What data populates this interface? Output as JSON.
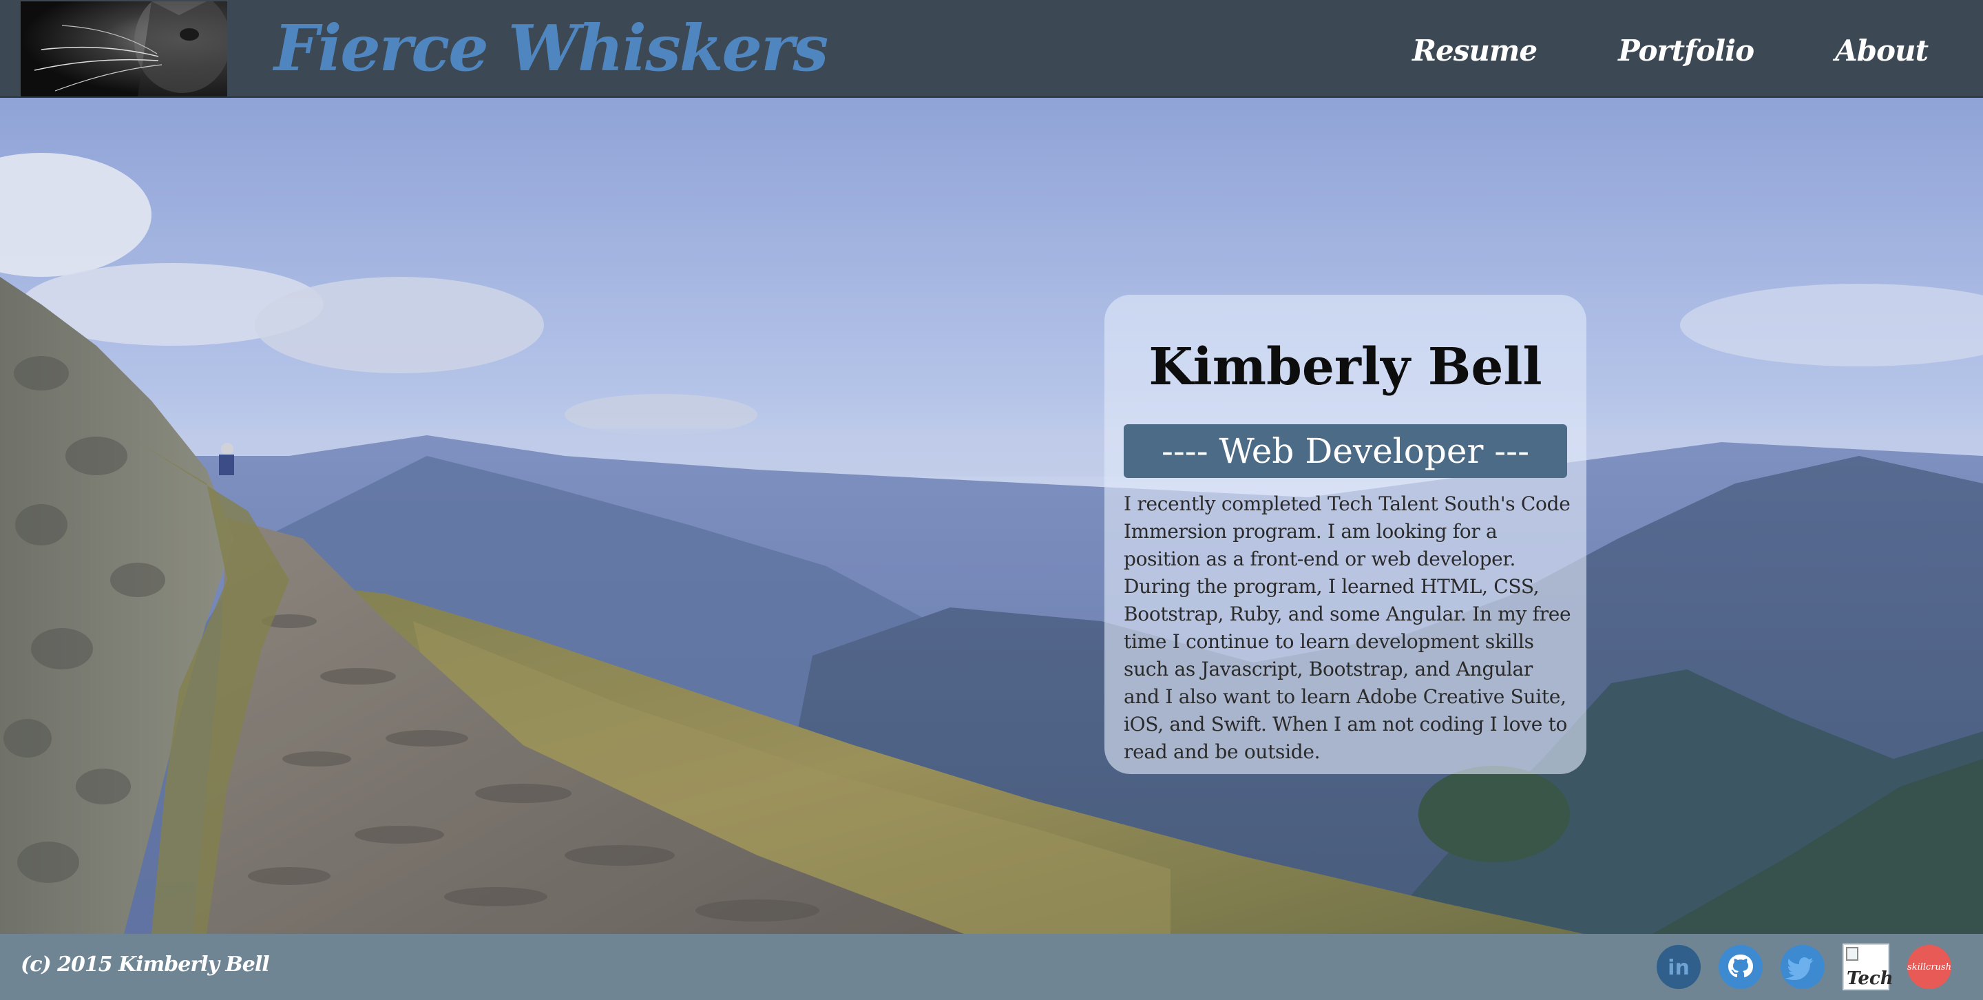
{
  "header": {
    "brand": "Fierce Whiskers",
    "nav": [
      {
        "label": "Resume"
      },
      {
        "label": "Portfolio"
      },
      {
        "label": "About"
      }
    ]
  },
  "profile": {
    "name": "Kimberly Bell",
    "role": "---- Web Developer ---",
    "bio": "I recently completed Tech Talent South's Code Immersion program. I am looking for a position as a front-end or web developer. During the program, I learned HTML, CSS, Bootstrap, Ruby, and some Angular. In my free time I continue to learn development skills such as Javascript, Bootstrap, and Angular and I also want to learn Adobe Creative Suite, iOS, and Swift. When I am not coding I love to read and be outside."
  },
  "footer": {
    "copyright": "(c) 2015 Kimberly Bell",
    "social": [
      {
        "icon": "linkedin-icon",
        "text": "in"
      },
      {
        "icon": "github-icon",
        "text": ""
      },
      {
        "icon": "twitter-icon",
        "text": ""
      },
      {
        "icon": "tech-talent-south-icon",
        "text": "Tech"
      },
      {
        "icon": "skillcrush-icon",
        "text": "skillcrush"
      }
    ]
  },
  "colors": {
    "header_bg": "#3c4853",
    "brand_blue": "#4f86c0",
    "role_banner": "#4c6b86",
    "footer_bg": "#6f8594"
  }
}
